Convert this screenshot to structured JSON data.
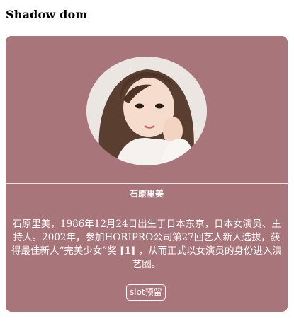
{
  "page": {
    "title": "Shadow dom"
  },
  "card": {
    "name": "石原里美",
    "bio_text": "石原里美，1986年12月24日出生于日本东京，日本女演员、主持人。2002年，参加HORIPRO公司第27回艺人新人选拔，获得最佳新人“完美少女”奖 ",
    "bio_ref": "[1]",
    "bio_tail": " ，从而正式以女演员的身份进入演艺圈。",
    "slot_label": "slot预留",
    "background_color": "#a8757b"
  }
}
